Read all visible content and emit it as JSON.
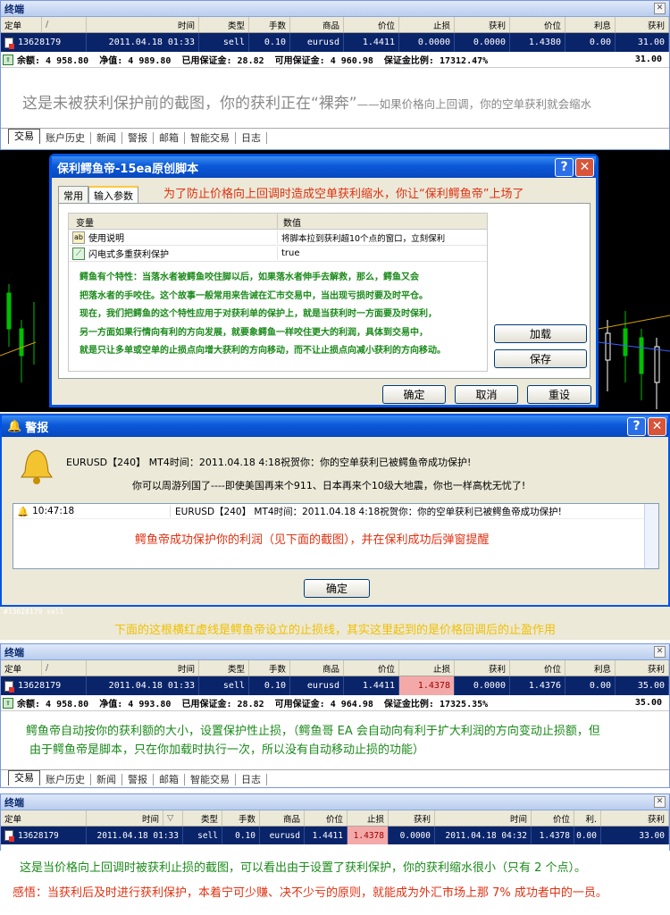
{
  "colors": {
    "accent": "#0054e3",
    "row_select": "#0a246a",
    "red_note": "#e03010",
    "green_note": "#1a8a1a",
    "stop_highlight": "#f4a9a9"
  },
  "terminal1": {
    "title": "终端",
    "headers": [
      "定单",
      "/",
      "时间",
      "类型",
      "手数",
      "商品",
      "价位",
      "止损",
      "获利",
      "价位",
      "利息",
      "获利"
    ],
    "row": [
      "13628179",
      "2011.04.18 01:33",
      "sell",
      "0.10",
      "eurusd",
      "1.4411",
      "0.0000",
      "0.0000",
      "1.4380",
      "0.00",
      "31.00"
    ],
    "summary": "余额: 4 958.80  净值: 4 989.80  已用保证金: 28.82  可用保证金: 4 960.98  保证金比例: 17312.47%",
    "summary_right": "31.00",
    "note": "这是未被获利保护前的截图，你的获利正在“裸奔”",
    "note_small": "——如果价格向上回调，你的空单获利就会缩水",
    "tabs": [
      "交易",
      "账户历史",
      "新闻",
      "警报",
      "邮箱",
      "智能交易",
      "日志"
    ]
  },
  "script_dialog": {
    "title": "保利鳄鱼帝-15ea原创脚本",
    "tabs": [
      "常用",
      "输入参数"
    ],
    "tab_note": "为了防止价格向上回调时造成空单获利缩水，你让“保利鳄鱼帝”上场了",
    "col_var": "变量",
    "col_val": "数值",
    "params": [
      {
        "name": "使用说明",
        "value": "将脚本拉到获利超10个点的窗口，立刻保利",
        "icon": "ab-icon"
      },
      {
        "name": "闪电式多重获利保护",
        "value": "true",
        "icon": "chart-icon"
      }
    ],
    "desc": [
      "鳄鱼有个特性：当落水者被鳄鱼咬住脚以后，如果落水者伸手去解救，那么，鳄鱼又会",
      "把落水者的手咬住。这个故事一般常用来告诫在汇市交易中，当出现亏损时要及时平仓。",
      "现在，我们把鳄鱼的这个特性应用于对获利单的保护上，就是当获利时一方面要及时保利，",
      "另一方面如果行情向有利的方向发展，就要象鳄鱼一样咬住更大的利润，具体到交易中，",
      "就是只让多单或空单的止损点向增大获利的方向移动，而不让止损点向减小获利的方向移动。"
    ],
    "btn_load": "加载",
    "btn_save": "保存",
    "btn_ok": "确定",
    "btn_cancel": "取消",
    "btn_reset": "重设"
  },
  "alert": {
    "title": "警报",
    "message": "EURUSD【240】 MT4时间：2011.04.18 4:18祝贺你：你的空单获利已被鳄鱼帝成功保护!",
    "message2": "你可以周游列国了----即使美国再来个911、日本再来个10级大地震，你也一样高枕无忧了!",
    "list_time": "10:47:18",
    "list_msg": "EURUSD【240】 MT4时间：2011.04.18 4:18祝贺你：你的空单获利已被鳄鱼帝成功保护!",
    "note": "鳄鱼帝成功保护你的利润（见下面的截图），并在保利成功后弹窗提醒",
    "btn_ok": "确定"
  },
  "chart_strip": {
    "label": "#13628179 sell",
    "note": "下面的这根横红虚线是鳄鱼帝设立的止损线，其实这里起到的是价格回调后的止盈作用"
  },
  "terminal2": {
    "title": "终端",
    "headers": [
      "定单",
      "/",
      "时间",
      "类型",
      "手数",
      "商品",
      "价位",
      "止损",
      "获利",
      "价位",
      "利息",
      "获利"
    ],
    "row": [
      "13628179",
      "2011.04.18 01:33",
      "sell",
      "0.10",
      "eurusd",
      "1.4411",
      "1.4378",
      "0.0000",
      "1.4376",
      "0.00",
      "35.00"
    ],
    "summary": "余额: 4 958.80  净值: 4 993.80  已用保证金: 28.82  可用保证金: 4 964.98  保证金比例: 17325.35%",
    "summary_right": "35.00",
    "note1": "鳄鱼帝自动按你的获利额的大小，设置保护性止损，（鳄鱼哥 EA 会自动向有利于扩大利润的方向变动止损额，但",
    "note2": "由于鳄鱼帝是脚本，只在你加载时执行一次，所以没有自动移动止损的功能）",
    "tabs": [
      "交易",
      "账户历史",
      "新闻",
      "警报",
      "邮箱",
      "智能交易",
      "日志"
    ]
  },
  "terminal3": {
    "title": "终端",
    "headers": [
      "定单",
      "时间",
      "▽",
      "类型",
      "手数",
      "商品",
      "价位",
      "止损",
      "获利",
      "时间",
      "价位",
      "利.",
      "获利"
    ],
    "row": [
      "13628179",
      "2011.04.18 01:33",
      "sell",
      "0.10",
      "eurusd",
      "1.4411",
      "1.4378",
      "0.0000",
      "2011.04.18 04:32",
      "1.4378",
      "0.00",
      "33.00"
    ],
    "note1": "这是当价格向上回调时被获利止损的截图，可以看出由于设置了获利保护，你的获利缩水很小（只有 2 个点）。",
    "note2": "感悟：当获利后及时进行获利保护，本着宁可少赚、决不少亏的原则，就能成为外汇市场上那 7% 成功者中的一员。"
  }
}
